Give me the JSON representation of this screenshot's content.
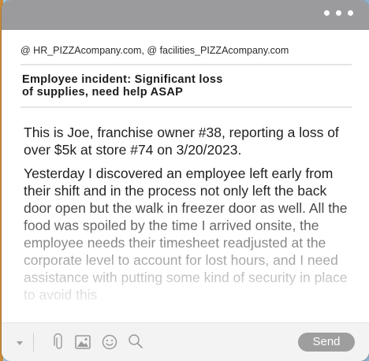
{
  "header": {
    "recipients": "@ HR_PIZZAcompany.com, @ facilities_PIZZAcompany.com",
    "more_icon": "more-horizontal-icon"
  },
  "subject": {
    "line1": "Employee incident: Significant loss",
    "line2": "of supplies, need help ASAP"
  },
  "body": {
    "paragraphs": [
      "This is Joe, franchise owner #38, reporting a loss of over $5k at store #74 on 3/20/2023.",
      "Yesterday I discovered an employee left early from their shift and in the process not only left the back door open but the walk in freezer door as well. All the food was spoiled by the time I arrived onsite, the employee needs their timesheet readjusted at the corporate level to account for lost hours, and I need assistance with putting some kind of security in place to avoid this"
    ]
  },
  "toolbar": {
    "send_label": "Send",
    "icons": [
      "chevron-down-icon",
      "paperclip-icon",
      "image-icon",
      "emoji-icon",
      "search-icon"
    ]
  },
  "colors": {
    "titlebar": "#9b9b9e",
    "send_button": "#9e9e9e",
    "toolbar_bg": "#f3f3f3"
  }
}
